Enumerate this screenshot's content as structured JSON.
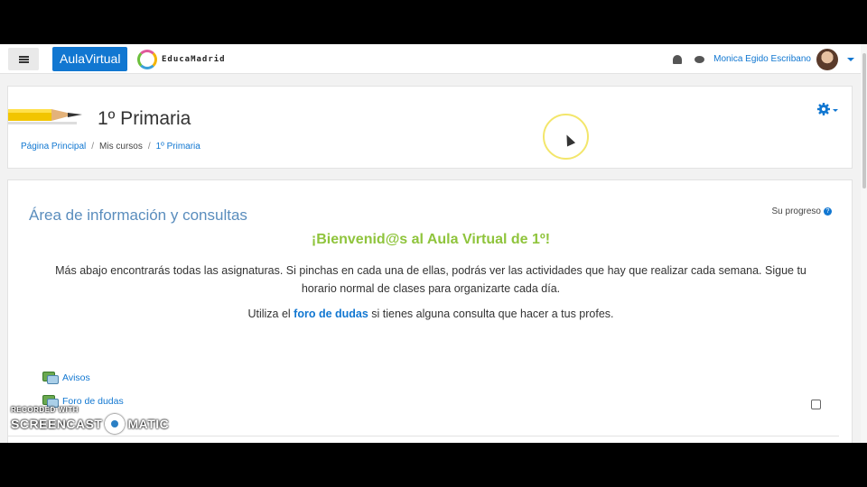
{
  "navbar": {
    "brand": "AulaVirtual",
    "logo_text": "EducaMadrid",
    "user_name": "Monica Egido Escribano"
  },
  "header": {
    "course_title": "1º Primaria",
    "breadcrumb": [
      "Página Principal",
      "Mis cursos",
      "1º Primaria"
    ]
  },
  "section": {
    "title": "Área de información y consultas",
    "progress_label": "Su progreso",
    "help_glyph": "?",
    "welcome": "¡Bienvenid@s al Aula Virtual de 1º!",
    "intro": "Más abajo encontrarás todas las asignaturas. Si pinchas en cada una de ellas, podrás ver las actividades que hay que realizar cada semana. Sigue tu horario normal de clases para organizarte cada día.",
    "forum_prefix": "Utiliza el ",
    "forum_link": "foro de dudas",
    "forum_suffix": " si tienes alguna consulta que hacer a tus profes.",
    "activities": [
      "Avisos",
      "Foro de dudas"
    ]
  },
  "watermark": {
    "line1": "RECORDED WITH",
    "left": "SCREENCAST",
    "right": "MATIC"
  },
  "colors": {
    "brand": "#1177d1",
    "welcome": "#8fc43c",
    "section_title": "#5a8dbd"
  }
}
